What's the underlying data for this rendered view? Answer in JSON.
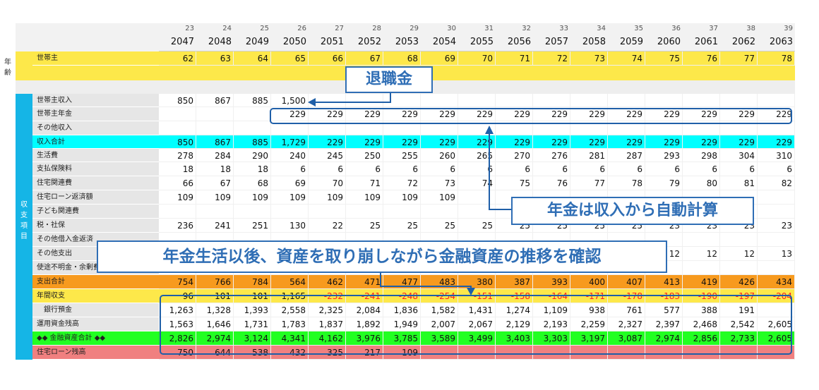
{
  "header": {
    "ages": [
      "23",
      "24",
      "25",
      "26",
      "27",
      "28",
      "29",
      "30",
      "31",
      "32",
      "33",
      "34",
      "35",
      "36",
      "37",
      "38",
      "39"
    ],
    "years": [
      "2047",
      "2048",
      "2049",
      "2050",
      "2051",
      "2052",
      "2053",
      "2054",
      "2055",
      "2056",
      "2057",
      "2058",
      "2059",
      "2060",
      "2061",
      "2062",
      "2063"
    ]
  },
  "side": {
    "age": "年\n齢",
    "income_expense": "収\n支\n項\n目"
  },
  "rows": [
    {
      "label": "世帯主",
      "values": [
        "62",
        "63",
        "64",
        "65",
        "66",
        "67",
        "68",
        "69",
        "70",
        "71",
        "72",
        "73",
        "74",
        "75",
        "76",
        "77",
        "78"
      ]
    },
    {
      "label": "世帯主収入",
      "values": [
        "850",
        "867",
        "885",
        "1,500",
        "",
        "",
        "",
        "",
        "",
        "",
        "",
        "",
        "",
        "",
        "",
        "",
        ""
      ]
    },
    {
      "label": "世帯主年金",
      "values": [
        "",
        "",
        "",
        "229",
        "229",
        "229",
        "229",
        "229",
        "229",
        "229",
        "229",
        "229",
        "229",
        "229",
        "229",
        "229",
        "229"
      ]
    },
    {
      "label": "その他収入",
      "values": [
        "",
        "",
        "",
        "",
        "",
        "",
        "",
        "",
        "",
        "",
        "",
        "",
        "",
        "",
        "",
        "",
        ""
      ]
    },
    {
      "label": "収入合計",
      "values": [
        "850",
        "867",
        "885",
        "1,729",
        "229",
        "229",
        "229",
        "229",
        "229",
        "229",
        "229",
        "229",
        "229",
        "229",
        "229",
        "229",
        "229"
      ]
    },
    {
      "label": "生活費",
      "values": [
        "278",
        "284",
        "290",
        "240",
        "245",
        "250",
        "255",
        "260",
        "265",
        "270",
        "276",
        "281",
        "287",
        "293",
        "298",
        "304",
        "310"
      ]
    },
    {
      "label": "支払保険料",
      "values": [
        "18",
        "18",
        "18",
        "6",
        "6",
        "6",
        "6",
        "6",
        "6",
        "6",
        "6",
        "6",
        "6",
        "6",
        "6",
        "6",
        "6"
      ]
    },
    {
      "label": "住宅関連費",
      "values": [
        "66",
        "67",
        "68",
        "69",
        "70",
        "71",
        "72",
        "73",
        "74",
        "75",
        "76",
        "77",
        "78",
        "79",
        "80",
        "81",
        "82"
      ]
    },
    {
      "label": "住宅ローン返済額",
      "values": [
        "109",
        "109",
        "109",
        "109",
        "109",
        "109",
        "109",
        "109",
        "",
        "",
        "",
        "",
        "",
        "",
        "",
        "",
        ""
      ]
    },
    {
      "label": "子ども関連費",
      "values": [
        "",
        "",
        "",
        "",
        "",
        "",
        "",
        "",
        "",
        "",
        "",
        "",
        "",
        "",
        "",
        "",
        ""
      ]
    },
    {
      "label": "税・社保",
      "values": [
        "236",
        "241",
        "251",
        "130",
        "22",
        "25",
        "25",
        "25",
        "25",
        "25",
        "25",
        "25",
        "25",
        "23",
        "23",
        "23",
        "23"
      ]
    },
    {
      "label": "その他借入金返済",
      "values": [
        "",
        "",
        "",
        "",
        "",
        "",
        "",
        "",
        "",
        "",
        "",
        "",
        "",
        "",
        "",
        "",
        ""
      ]
    },
    {
      "label": "その他支出",
      "values": [
        "",
        "",
        "",
        "",
        "",
        "",
        "",
        "",
        "",
        "",
        "",
        "",
        "",
        "12",
        "12",
        "12",
        "13"
      ]
    },
    {
      "label": "使途不明金・余剰費",
      "values": [
        "",
        "",
        "",
        "",
        "",
        "",
        "",
        "",
        "",
        "",
        "",
        "",
        "",
        "",
        "",
        "",
        ""
      ]
    },
    {
      "label": "支出合計",
      "values": [
        "754",
        "766",
        "784",
        "564",
        "462",
        "471",
        "477",
        "483",
        "380",
        "387",
        "393",
        "400",
        "407",
        "413",
        "419",
        "426",
        "434"
      ]
    },
    {
      "label": "年間収支",
      "values": [
        "96",
        "101",
        "101",
        "1,165",
        "-232",
        "-241",
        "-248",
        "-254",
        "-151",
        "-158",
        "-164",
        "-171",
        "-178",
        "-183",
        "-190",
        "-197",
        "-204"
      ]
    },
    {
      "label": "銀行預金",
      "values": [
        "1,263",
        "1,328",
        "1,393",
        "2,558",
        "2,325",
        "2,084",
        "1,836",
        "1,582",
        "1,431",
        "1,274",
        "1,109",
        "938",
        "761",
        "577",
        "388",
        "191",
        ""
      ]
    },
    {
      "label": "運用資金残高",
      "values": [
        "1,563",
        "1,646",
        "1,731",
        "1,783",
        "1,837",
        "1,892",
        "1,949",
        "2,007",
        "2,067",
        "2,129",
        "2,193",
        "2,259",
        "2,327",
        "2,397",
        "2,468",
        "2,542",
        "2,605"
      ]
    },
    {
      "label": "◆◆ 金融資産合計 ◆◆",
      "values": [
        "2,826",
        "2,974",
        "3,124",
        "4,341",
        "4,162",
        "3,976",
        "3,785",
        "3,589",
        "3,499",
        "3,403",
        "3,303",
        "3,197",
        "3,087",
        "2,974",
        "2,856",
        "2,733",
        "2,605"
      ]
    },
    {
      "label": "住宅ローン残高",
      "values": [
        "750",
        "644",
        "538",
        "432",
        "325",
        "217",
        "109",
        "",
        "",
        "",
        "",
        "",
        "",
        "",
        "",
        "",
        ""
      ]
    }
  ],
  "callouts": {
    "retirement": "退職金",
    "pension": "年金は収入から自動計算",
    "assets": "年金生活以後、資産を取り崩しながら金融資産の推移を確認"
  },
  "colors": {
    "yellow": "#fde84a",
    "cyan": "#00ffff",
    "orange": "#f79a1e",
    "green": "#22ff22",
    "pink": "#f08080",
    "label_gray": "#e6e6e6",
    "side_blue": "#15b5e6",
    "negative": "#ff2020",
    "accent": "#2f6eb5"
  }
}
